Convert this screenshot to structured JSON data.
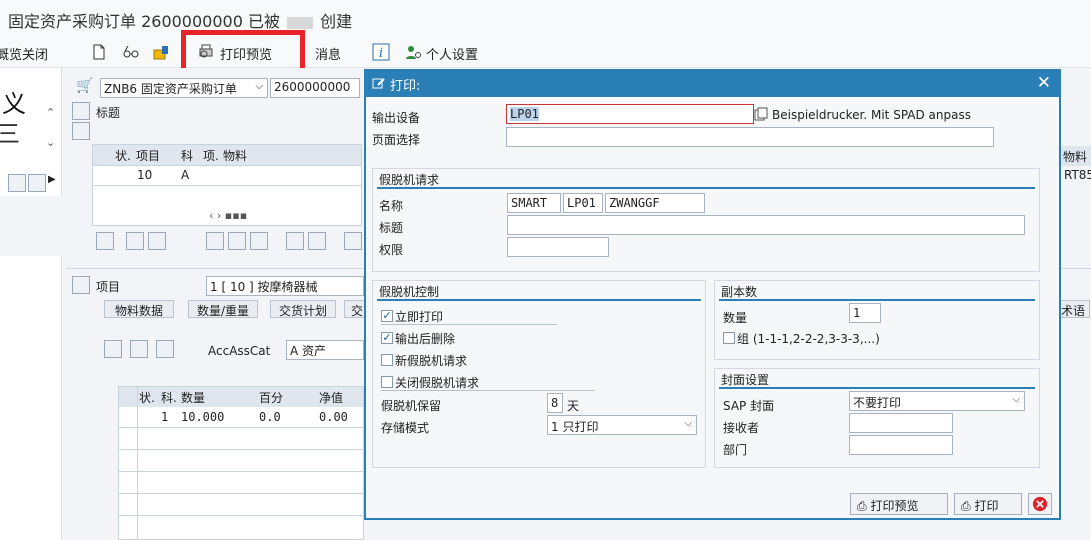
{
  "window": {
    "title_prefix": "固定资产采购订单 2600000000 已被",
    "title_suffix": "创建"
  },
  "toolbar": {
    "overview_close": "概览关闭",
    "print_preview": "打印预览",
    "messages": "消息",
    "personal_settings": "个人设置"
  },
  "background": {
    "left_big_1": "义",
    "left_big_2": "三",
    "doc_type": "ZNB6 固定资产采购订单",
    "doc_number": "2600000000",
    "header_label": "标题",
    "items_columns": [
      "状.",
      "项目",
      "科",
      "项.",
      "物料"
    ],
    "item_row": {
      "item": "10",
      "category": "A"
    },
    "right_col_header": "物料",
    "right_col_value": "RT85",
    "item_label": "项目",
    "item_select": "1 [ 10 ] 按摩椅器械",
    "tabs": [
      "物料数据",
      "数量/重量",
      "交货计划",
      "交"
    ],
    "tab_right": "术语",
    "accasscat_label": "AccAssCat",
    "accasscat_value": "A 资产",
    "acct_columns": [
      "状.",
      "科.",
      "数量",
      "百分",
      "净值"
    ],
    "acct_row": {
      "no": "1",
      "qty": "10.000",
      "pct": "0.0",
      "net": "0.00"
    }
  },
  "dialog": {
    "title": "打印:",
    "output_device_label": "输出设备",
    "output_device_value": "LP01",
    "output_device_desc": "Beispieldrucker. Mit SPAD anpass",
    "page_selection_label": "页面选择",
    "spool_request": {
      "title": "假脱机请求",
      "name_label": "名称",
      "name_values": [
        "SMART",
        "LP01",
        "ZWANGGF"
      ],
      "title_label": "标题",
      "auth_label": "权限"
    },
    "spool_control": {
      "title": "假脱机控制",
      "print_now": "立即打印",
      "delete_after": "输出后删除",
      "new_spool": "新假脱机请求",
      "close_spool": "关闭假脱机请求",
      "retention_label": "假脱机保留",
      "retention_value": "8",
      "retention_unit": "天",
      "storage_label": "存储模式",
      "storage_value": "1 只打印"
    },
    "copies": {
      "title": "副本数",
      "count_label": "数量",
      "count_value": "1",
      "group_label": "组 (1-1-1,2-2-2,3-3-3,...)"
    },
    "cover": {
      "title": "封面设置",
      "sap_cover_label": "SAP 封面",
      "sap_cover_value": "不要打印",
      "recipient_label": "接收者",
      "department_label": "部门"
    },
    "buttons": {
      "preview": "打印预览",
      "print": "打印"
    }
  }
}
